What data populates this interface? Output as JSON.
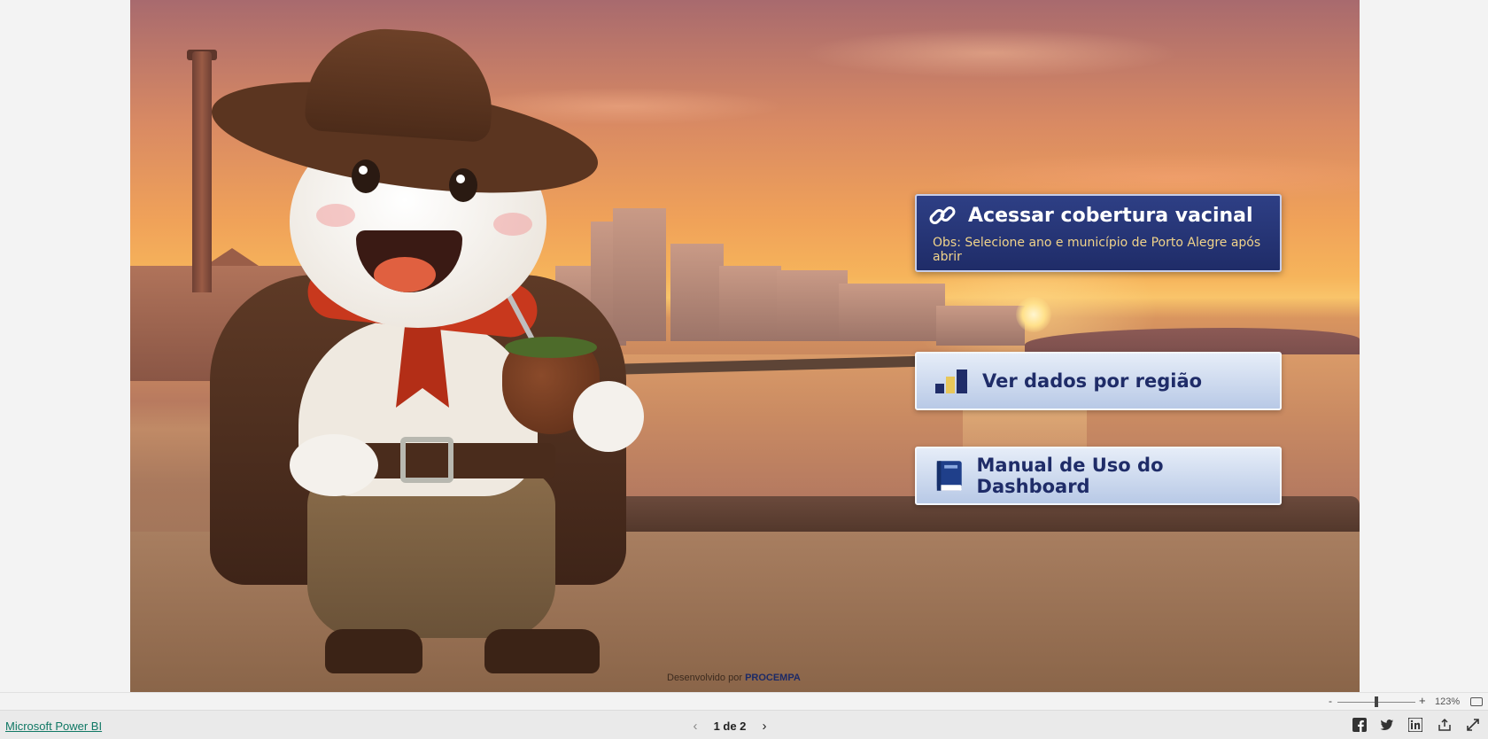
{
  "buttons": {
    "cobertura": {
      "title": "Acessar cobertura vacinal",
      "note": "Obs: Selecione ano e município de Porto Alegre após abrir",
      "icon": "link-icon"
    },
    "regiao": {
      "title": "Ver dados por região",
      "icon": "bar-chart-icon"
    },
    "manual": {
      "title": "Manual de Uso do Dashboard",
      "icon": "book-icon"
    }
  },
  "credit": {
    "prefix": "Desenvolvido por",
    "org": "PROCEMPA"
  },
  "zoom": {
    "minus": "-",
    "plus": "+",
    "percent": "123%"
  },
  "footer": {
    "brand_link": "Microsoft Power BI",
    "page_indicator": "1 de 2",
    "prev": "‹",
    "next": "›"
  },
  "colors": {
    "primary_button": "#1f2c68",
    "note_text": "#f0d38a",
    "brand_link": "#117865"
  }
}
